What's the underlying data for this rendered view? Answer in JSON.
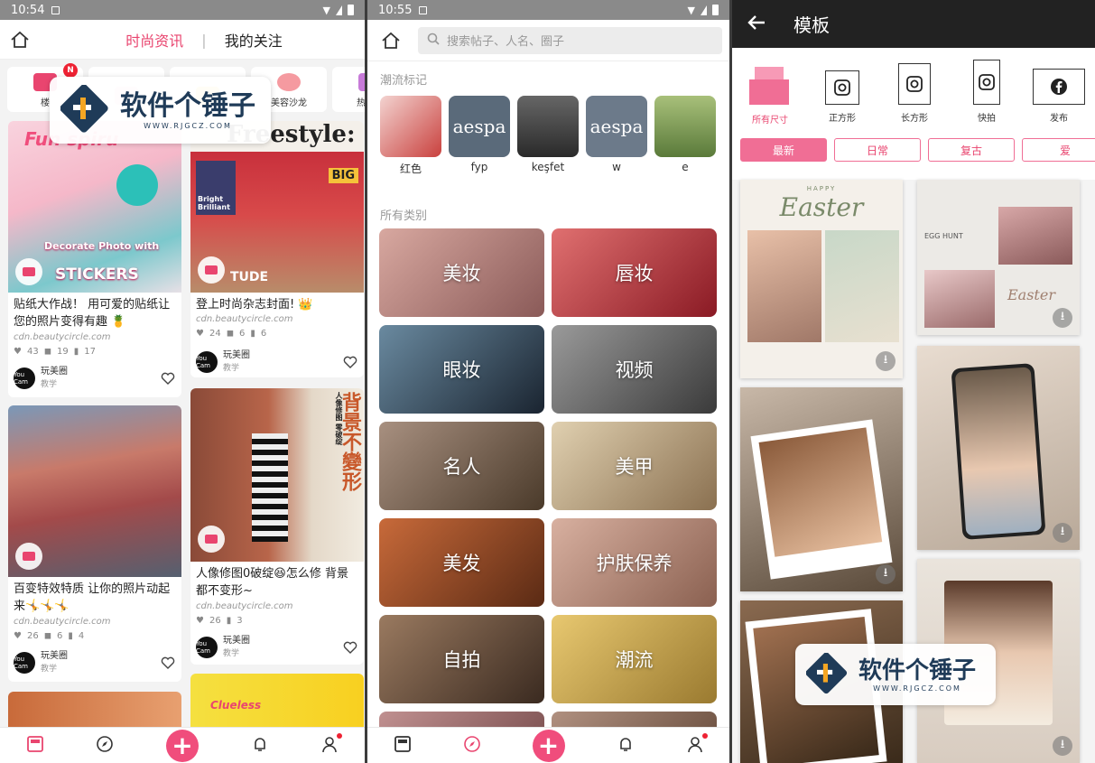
{
  "status_bar": {
    "time_1": "10:54",
    "time_2": "10:55"
  },
  "panel1": {
    "tab_primary": "时尚资讯",
    "tab_secondary": "我的关注",
    "separator": "|",
    "shortcuts": [
      {
        "label": "楼",
        "badge": "N"
      },
      {
        "label": ""
      },
      {
        "label": ""
      },
      {
        "label": "美容沙龙"
      },
      {
        "label": "热门玩"
      }
    ],
    "cards": [
      {
        "overlay_top": "Fun spiru",
        "overlay_mid": "Decorate Photo with",
        "overlay_big": "STICKERS",
        "title": "贴纸大作战！ 用可爱的贴纸让您的照片变得有趣 🍍",
        "source": "cdn.beautycircle.com",
        "likes": "43",
        "comments": "19",
        "saves": "17",
        "author": "玩美圈",
        "author_tag": "教学"
      },
      {
        "overlay_top": "Freestyle:",
        "overlay_mid": "TUDE",
        "mag_big": "BIG",
        "mag_small": "Bright Brilliant",
        "title": "登上时尚杂志封面! 👑",
        "source": "cdn.beautycircle.com",
        "likes": "24",
        "comments": "6",
        "saves": "6",
        "author": "玩美圈",
        "author_tag": "教学"
      },
      {
        "title": "百变特效特质 让你的照片动起来🤸🤸🤸",
        "source": "cdn.beautycircle.com",
        "likes": "26",
        "comments": "6",
        "saves": "4",
        "author": "玩美圈",
        "author_tag": "教学"
      },
      {
        "overlay_vertical": "背景不變形",
        "overlay_small": "人像修图 零破绽",
        "title": "人像修图0破绽😆怎么修 背景都不变形~",
        "source": "cdn.beautycircle.com",
        "likes": "26",
        "saves": "3",
        "author": "玩美圈",
        "author_tag": "教学"
      },
      {
        "overlay_top": "Clueless"
      }
    ],
    "avatar_text": "You Cam"
  },
  "panel2": {
    "search_placeholder": "搜索帖子、人名、圈子",
    "trending_label": "潮流标记",
    "trending": [
      {
        "label": "红色",
        "color": "#c9413e",
        "thumb_text": ""
      },
      {
        "label": "fyp",
        "color": "#5a6a7a",
        "thumb_text": "aespa"
      },
      {
        "label": "keşfet",
        "color": "#3a3a3a",
        "thumb_text": ""
      },
      {
        "label": "w",
        "color": "#6c7a8a",
        "thumb_text": "aespa"
      },
      {
        "label": "e",
        "color": "#7a8a4a",
        "thumb_text": ""
      }
    ],
    "categories_label": "所有类别",
    "categories": [
      {
        "label": "美妆",
        "color": "#b07a78"
      },
      {
        "label": "唇妆",
        "color": "#b03a40"
      },
      {
        "label": "眼妆",
        "color": "#3a4c5a"
      },
      {
        "label": "视频",
        "color": "#6a6a6a"
      },
      {
        "label": "名人",
        "color": "#7a6a5a"
      },
      {
        "label": "美甲",
        "color": "#b9a58a"
      },
      {
        "label": "美发",
        "color": "#a05030"
      },
      {
        "label": "护肤保养",
        "color": "#b08a7a"
      },
      {
        "label": "自拍",
        "color": "#6a5040"
      },
      {
        "label": "潮流",
        "color": "#c0a050"
      },
      {
        "label": "",
        "color": "#a07070"
      },
      {
        "label": "",
        "color": "#8a7060"
      }
    ]
  },
  "panel3": {
    "title": "模板",
    "templates": [
      {
        "label": "所有尺寸"
      },
      {
        "label": "正方形"
      },
      {
        "label": "长方形"
      },
      {
        "label": "快拍"
      },
      {
        "label": "发布"
      }
    ],
    "filters": [
      "最新",
      "日常",
      "复古",
      "爱"
    ],
    "card_texts": {
      "easter": "Easter",
      "happy": "HAPPY",
      "egg_hunt": "EGG HUNT",
      "easter2": "Easter"
    }
  },
  "watermark": {
    "brand": "软件个锤子",
    "url": "WWW.RJGCZ.COM"
  },
  "colors": {
    "accent": "#e9456f",
    "pink_button": "#f04d7c"
  }
}
